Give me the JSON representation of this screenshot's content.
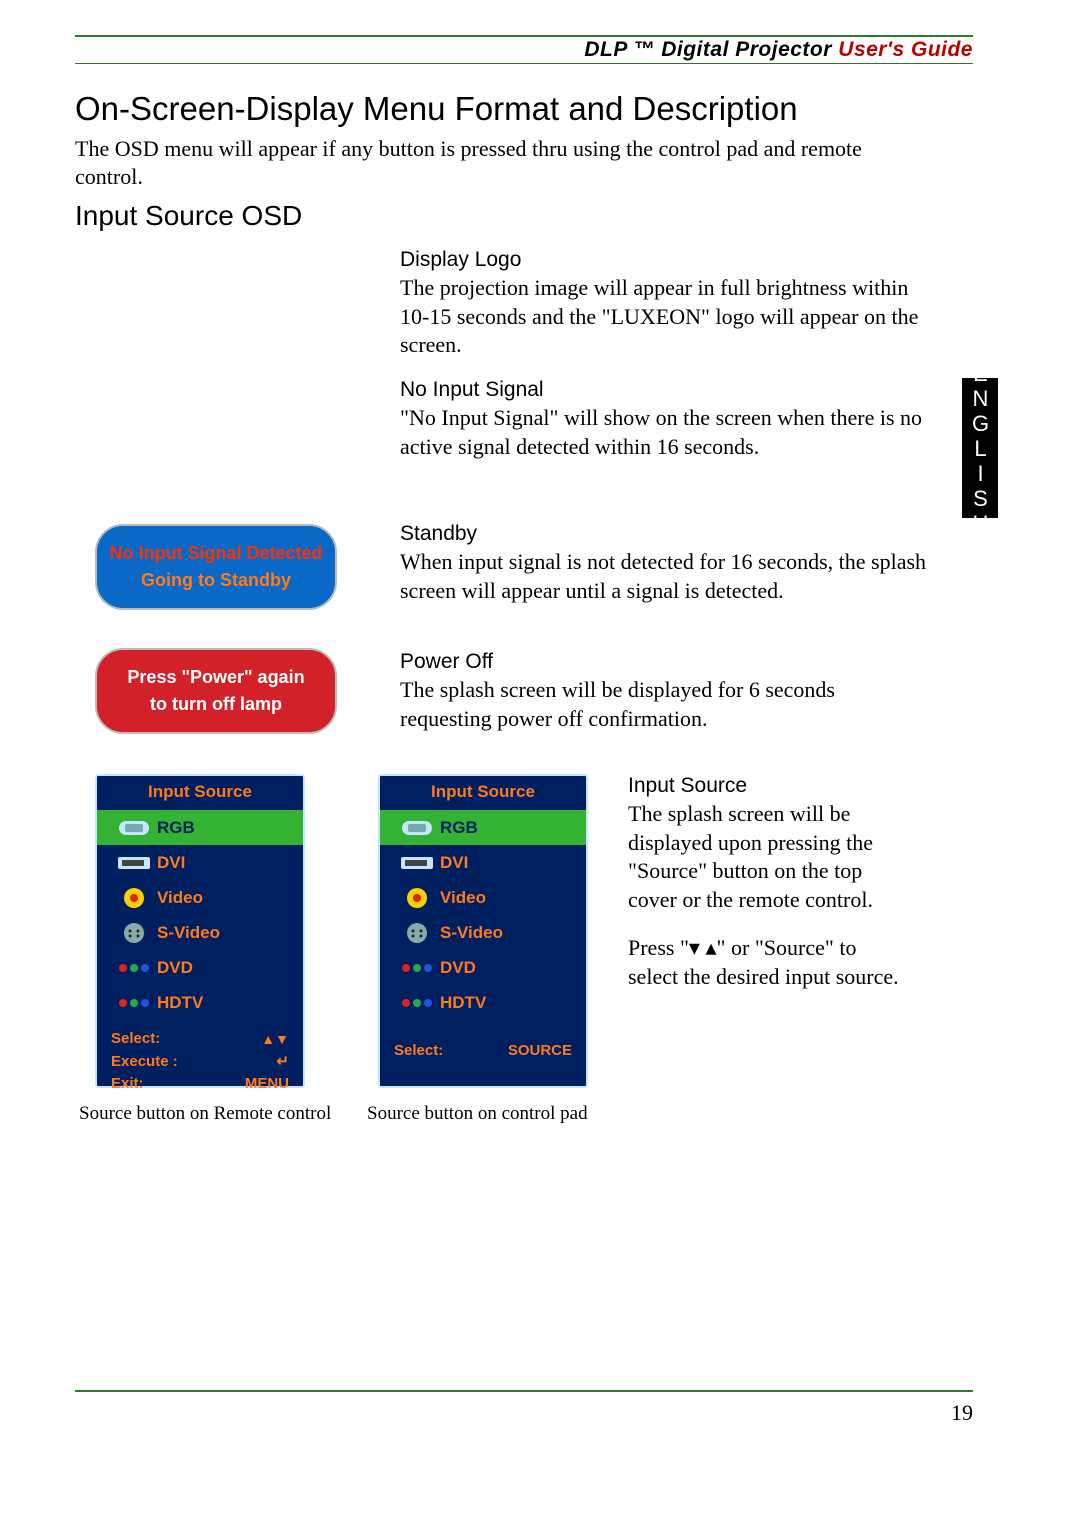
{
  "header": {
    "left": "DLP ™ Digital Projector",
    "right": "User's Guide"
  },
  "h1": "On-Screen-Display Menu   Format and Description",
  "intro": "The OSD menu will appear if any button is pressed thru using the control pad and remote control.",
  "h2": "Input Source OSD",
  "lang_tab": "ENGLISH",
  "sections": {
    "display": {
      "title": "Display Logo",
      "body": "The projection image will appear in full brightness within 10-15 seconds and the \"LUXEON\" logo will appear on the screen."
    },
    "noinput": {
      "title": "No Input Signal",
      "body": "\"No Input Signal\" will show on the screen when there is no active signal detected within 16 seconds."
    },
    "standby": {
      "title": "Standby",
      "body": "When input signal is not detected for 16 seconds, the splash screen will appear until a signal is detected."
    },
    "poweroff": {
      "title": "Power Off",
      "body": "The splash screen will be displayed for 6 seconds requesting power off confirmation."
    }
  },
  "osd_standby": {
    "line1": "No Input Signal Detected",
    "line2": "Going to Standby"
  },
  "osd_poweroff": {
    "line1": "Press \"Power\" again",
    "line2": "to turn off lamp"
  },
  "input_panel": {
    "title": "Input Source",
    "items": [
      "RGB",
      "DVI",
      "Video",
      "S-Video",
      "DVD",
      "HDTV"
    ],
    "footer_remote": {
      "select": "Select:",
      "execute": "Execute :",
      "exit": "Exit:",
      "menu": "MENU",
      "enter": "↵"
    },
    "footer_controlpad": {
      "select": "Select:",
      "source": "SOURCE"
    }
  },
  "captions": {
    "remote": "Source button on Remote control",
    "controlpad": "Source button on control pad"
  },
  "input_source_text": {
    "title": "Input Source",
    "p1": "The splash screen will be displayed upon pressing the \"Source\" button on the top cover or the remote control.",
    "p2": "Press \"▾ ▴\"    or \"Source\" to select the desired input source."
  },
  "page_num": "19"
}
